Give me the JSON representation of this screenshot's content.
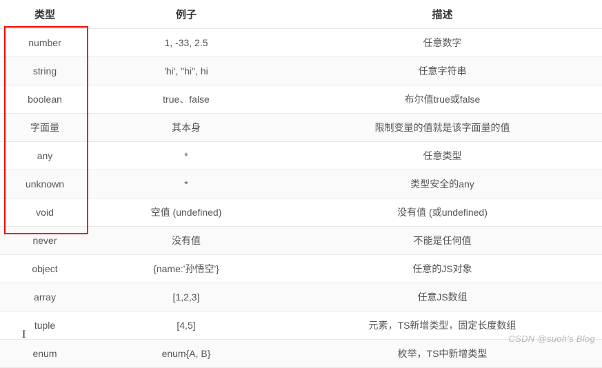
{
  "headers": {
    "type": "类型",
    "example": "例子",
    "description": "描述"
  },
  "rows": [
    {
      "type": "number",
      "example": "1, -33, 2.5",
      "description": "任意数字"
    },
    {
      "type": "string",
      "example": "'hi', \"hi\", hi",
      "description": "任意字符串"
    },
    {
      "type": "boolean",
      "example": "true、false",
      "description": "布尔值true或false"
    },
    {
      "type": "字面量",
      "example": "其本身",
      "description": "限制变量的值就是该字面量的值"
    },
    {
      "type": "any",
      "example": "*",
      "description": "任意类型"
    },
    {
      "type": "unknown",
      "example": "*",
      "description": "类型安全的any"
    },
    {
      "type": "void",
      "example": "空值 (undefined)",
      "description": "没有值 (或undefined)"
    },
    {
      "type": "never",
      "example": "没有值",
      "description": "不能是任何值"
    },
    {
      "type": "object",
      "example": "{name:'孙悟空'}",
      "description": "任意的JS对象"
    },
    {
      "type": "array",
      "example": "[1,2,3]",
      "description": "任意JS数组"
    },
    {
      "type": "tuple",
      "example": "[4,5]",
      "description": "元素，TS新增类型，固定长度数组"
    },
    {
      "type": "enum",
      "example": "enum{A, B}",
      "description": "枚举，TS中新增类型"
    }
  ],
  "watermark": "CSDN @suoh's Blog"
}
